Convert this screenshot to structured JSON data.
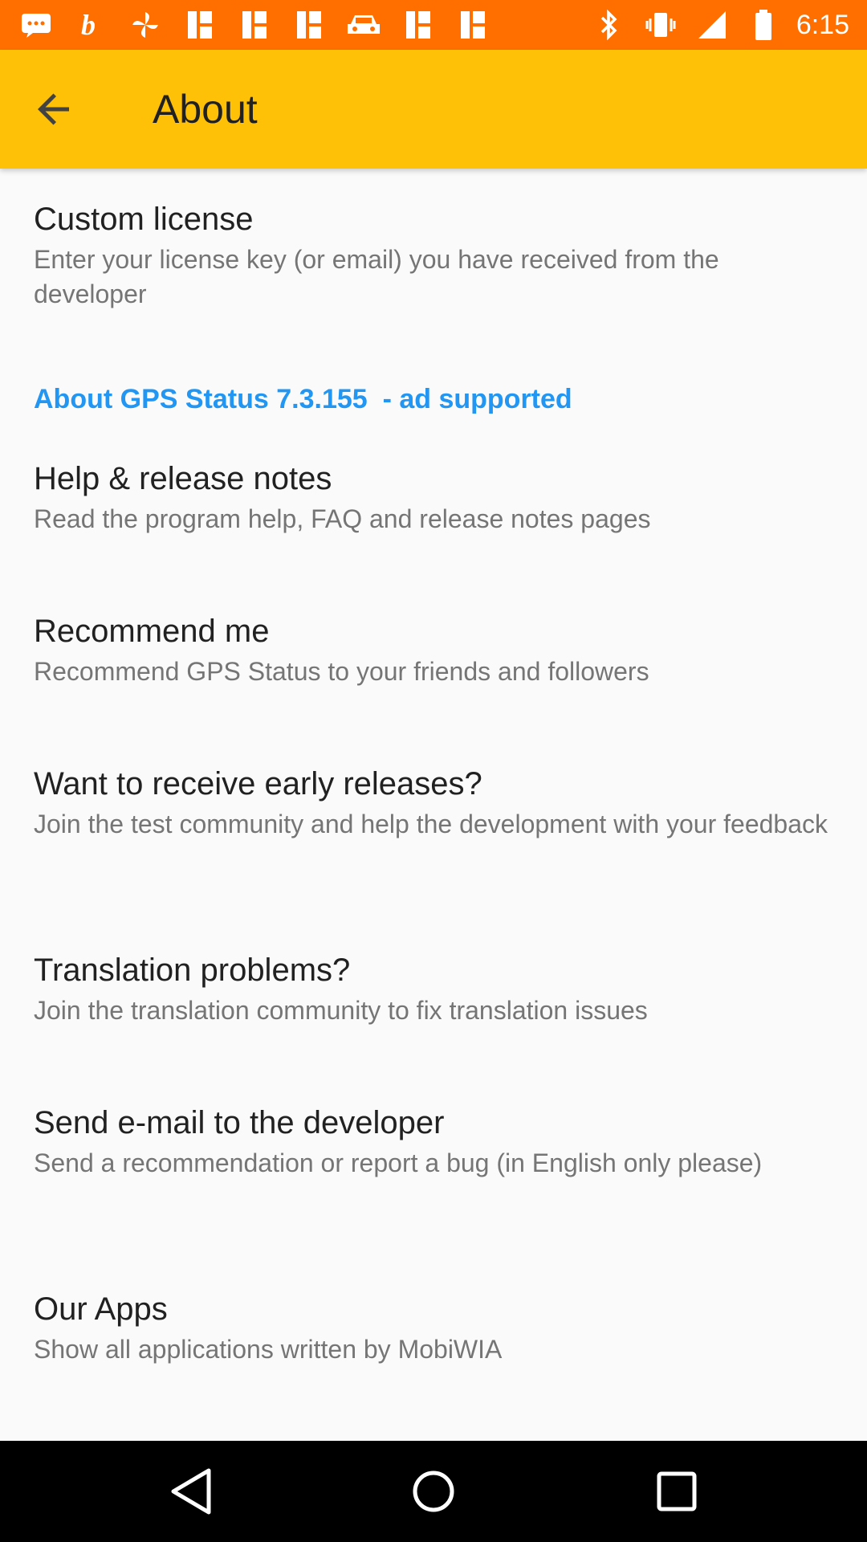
{
  "status_bar": {
    "time": "6:15",
    "icons": [
      "message-icon",
      "b-app-icon",
      "pinwheel-icon",
      "fb-icon",
      "fb-icon",
      "fb-icon",
      "car-icon",
      "fb-icon",
      "fb-icon",
      "bluetooth-icon",
      "vibrate-icon",
      "signal-icon",
      "battery-icon"
    ]
  },
  "app_bar": {
    "title": "About",
    "back_icon": "arrow-back-icon"
  },
  "preferences": {
    "custom_license": {
      "title": "Custom license",
      "summary": "Enter your license key (or email) you have received from the developer"
    },
    "section_header": "About GPS Status 7.3.155  - ad supported",
    "help": {
      "title": "Help & release notes",
      "summary": "Read the program help, FAQ and release notes pages"
    },
    "recommend": {
      "title": "Recommend me",
      "summary": "Recommend GPS Status to your friends and followers"
    },
    "early": {
      "title": "Want to receive early releases?",
      "summary": "Join the test community and help the development with your feedback"
    },
    "translation": {
      "title": "Translation problems?",
      "summary": "Join the translation community to fix translation issues"
    },
    "email": {
      "title": "Send e-mail to the developer",
      "summary": "Send a recommendation or report a bug (in English only please)"
    },
    "apps": {
      "title": "Our Apps",
      "summary": "Show all applications written by MobiWIA"
    }
  },
  "nav_bar": {
    "back": "nav-back-icon",
    "home": "nav-home-icon",
    "recents": "nav-recents-icon"
  },
  "colors": {
    "status_bar": "#ff6f00",
    "app_bar": "#ffc107",
    "accent": "#2196f3",
    "background": "#fafafa"
  }
}
